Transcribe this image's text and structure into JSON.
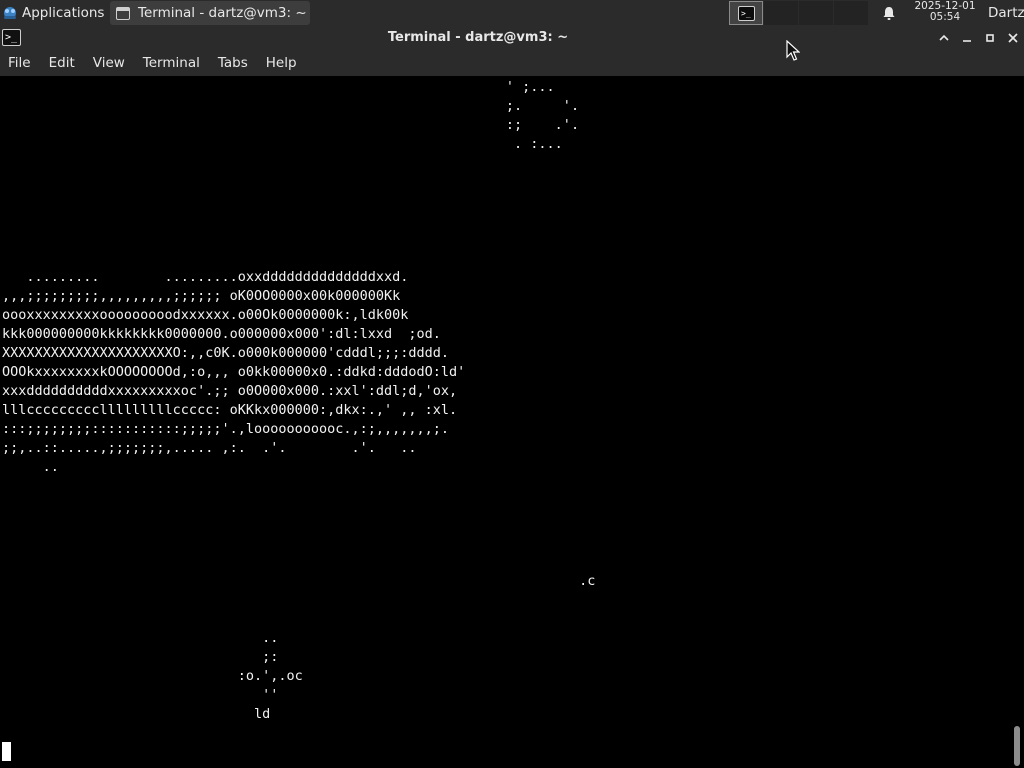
{
  "panel": {
    "applications_label": "Applications",
    "task_button_label": "Terminal - dartz@vm3: ~",
    "workspace_icon_glyph": ">_",
    "clock_date": "2025-12-01",
    "clock_time": "05:54",
    "user_label": "Dartz",
    "apps_icon": "xfce-mouse-icon",
    "bell_icon": "notification-bell-icon"
  },
  "window": {
    "title": "Terminal - dartz@vm3: ~",
    "icon_glyph": ">_"
  },
  "menu": [
    "File",
    "Edit",
    "View",
    "Terminal",
    "Tabs",
    "Help"
  ],
  "terminal": {
    "lines": [
      {
        "row": 0,
        "col": 0,
        "text": "                                                              ' ;..."
      },
      {
        "row": 1,
        "col": 0,
        "text": "                                                              ;.     '."
      },
      {
        "row": 2,
        "col": 0,
        "text": "                                                              :;    .'."
      },
      {
        "row": 3,
        "col": 0,
        "text": "                                                               . :..."
      },
      {
        "row": 10,
        "col": 0,
        "text": "   .........        .........oxxddddddddddddddxxd."
      },
      {
        "row": 11,
        "col": 0,
        "text": ",,,;;;;;;;;;,,,,,,,,,;;;;;; oK0OO0000x00k000000Kk"
      },
      {
        "row": 12,
        "col": 0,
        "text": "oooxxxxxxxxxooooooooodxxxxxx.o00Ok0000000k:,ldk00k"
      },
      {
        "row": 13,
        "col": 0,
        "text": "kkk000000000kkkkkkkk0000000.o000000x000':dl:lxxd  ;od."
      },
      {
        "row": 14,
        "col": 0,
        "text": "XXXXXXXXXXXXXXXXXXXXXO:,,c0K.o000k000000'cdddl;;;:dddd."
      },
      {
        "row": 15,
        "col": 0,
        "text": "OOOkxxxxxxxxkOOOOOOOOd,:o,,, o0kk00000x0.:ddkd:dddodO:ld'"
      },
      {
        "row": 16,
        "col": 0,
        "text": "xxxddddddddddxxxxxxxxxoc'.;; o0O000x000.:xxl':ddl;d,'ox,"
      },
      {
        "row": 17,
        "col": 0,
        "text": "lllccccccccclllllllllccccc: oKKkx000000:,dkx:.,' ,, :xl."
      },
      {
        "row": 18,
        "col": 0,
        "text": ":::;;;;;;;;:::::::::::;;;;;'.,looooooooooc.,:;,,,,,,,;."
      },
      {
        "row": 19,
        "col": 0,
        "text": ";;,..::.....,;;;;;;;,..... ,:.  .'.        .'.   .."
      },
      {
        "row": 20,
        "col": 0,
        "text": "     .."
      },
      {
        "row": 26,
        "col": 0,
        "text": "                                                                       .c"
      },
      {
        "row": 29,
        "col": 0,
        "text": "                                .."
      },
      {
        "row": 30,
        "col": 0,
        "text": "                                ;:"
      },
      {
        "row": 31,
        "col": 0,
        "text": "                             :o.',.oc"
      },
      {
        "row": 32,
        "col": 0,
        "text": "                                ''"
      },
      {
        "row": 33,
        "col": 0,
        "text": "                               ld"
      }
    ]
  }
}
